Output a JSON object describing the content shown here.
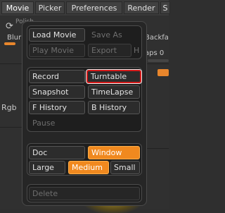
{
  "menubar": {
    "tabs": [
      {
        "label": "Movie",
        "active": true
      },
      {
        "label": "Picker",
        "active": false
      },
      {
        "label": "Preferences",
        "active": false
      },
      {
        "label": "Render",
        "active": false
      },
      {
        "label": "S",
        "active": false
      }
    ]
  },
  "background": {
    "blur_label": "Blur",
    "backface_label": "Backfa",
    "caps_label": "aps 0",
    "rgb_label": "Rgb",
    "polish_label": "Polish",
    "icons": [
      "refresh-icon"
    ]
  },
  "popup": {
    "group1": {
      "load_movie": "Load Movie",
      "save_as": "Save As",
      "play_movie": "Play Movie",
      "export": "Export",
      "export_hotkey": "H"
    },
    "group2": {
      "record": "Record",
      "turntable": "Turntable",
      "snapshot": "Snapshot",
      "timelapse": "TimeLapse",
      "f_history": "F History",
      "b_history": "B History",
      "pause": "Pause"
    },
    "group3": {
      "doc": "Doc",
      "window": "Window",
      "large": "Large",
      "medium": "Medium",
      "small": "Small"
    },
    "group4": {
      "delete": "Delete"
    }
  },
  "colors": {
    "accent": "#f0891f",
    "highlight": "#d41a1a"
  }
}
